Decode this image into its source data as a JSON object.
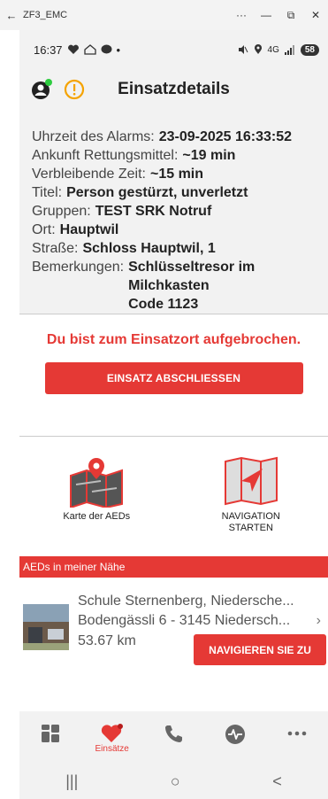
{
  "window": {
    "title": "ZF3_EMC",
    "back": "←",
    "minimize": "—",
    "maximize": "⧉",
    "more": "···",
    "close": "✕"
  },
  "status_bar": {
    "time": "16:37",
    "dot": "•",
    "battery": "58",
    "signal": "4G"
  },
  "header": {
    "title": "Einsatzdetails"
  },
  "details": {
    "alarm_time_label": "Uhrzeit des Alarms:",
    "alarm_time_value": "23-09-2025 16:33:52",
    "arrival_label": "Ankunft Rettungsmittel:",
    "arrival_value": "~19 min",
    "remaining_label": "Verbleibende Zeit:",
    "remaining_value": "~15 min",
    "title_label": "Titel:",
    "title_value": "Person gestürzt, unverletzt",
    "groups_label": "Gruppen:",
    "groups_value": "TEST SRK Notruf",
    "place_label": "Ort:",
    "place_value": "Hauptwil",
    "street_label": "Straße:",
    "street_value": "Schloss Hauptwil, 1",
    "remarks_label": "Bemerkungen:",
    "remarks_value": [
      "Schlüsseltresor im",
      "Milchkasten",
      "Code 1123"
    ]
  },
  "status_message": "Du bist zum Einsatzort aufgebrochen.",
  "close_button": "EINSATZ ABSCHLIESSEN",
  "actions": {
    "aed_map": "Karte der AEDs",
    "navigation": [
      "NAVIGATION",
      "STARTEN"
    ]
  },
  "aed_section": {
    "title": "AEDs in meiner Nähe",
    "item": {
      "name": "Schule Sternenberg, Niedersche...",
      "address": "Bodengässli 6 - 3145 Niedersch...",
      "distance": "53.67 km",
      "navigate_button": "NAVIGIEREN SIE ZU"
    }
  },
  "tabs": {
    "active_label": "Einsätze"
  },
  "sysnav": {
    "recents": "|||",
    "home": "○",
    "back": "<"
  },
  "colors": {
    "accent": "#e53935",
    "background": "#f2f2f2"
  }
}
